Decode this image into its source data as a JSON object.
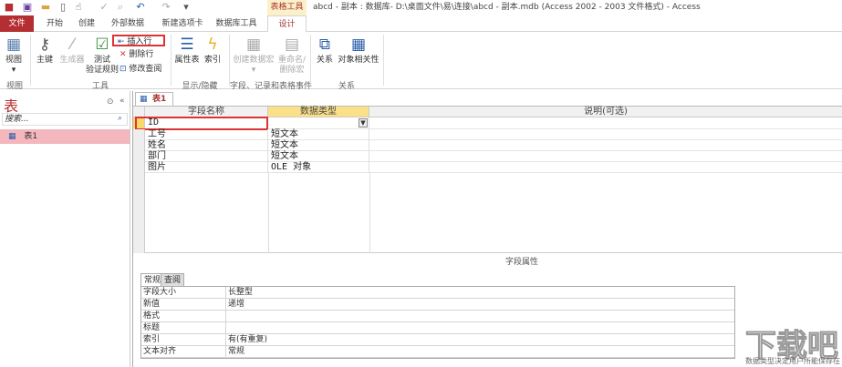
{
  "titlebar": {
    "context_group": "表格工具",
    "title": "abcd - 副本 : 数据库- D:\\桌面文件\\易\\连接\\abcd - 副本.mdb (Access 2002 - 2003 文件格式) - Access"
  },
  "tabs": [
    "文件",
    "开始",
    "创建",
    "外部数据",
    "新建选项卡",
    "数据库工具",
    "设计"
  ],
  "ribbon": {
    "view": "视图",
    "view_group": "视图",
    "primary_key": "主键",
    "builder": "生成器",
    "test_rules_1": "测试",
    "test_rules_2": "验证规则",
    "insert_row": "插入行",
    "delete_row": "删除行",
    "modify_lookup": "修改查阅",
    "tools_group": "工具",
    "property_sheet": "属性表",
    "indexes": "索引",
    "show_hide_group": "显示/隐藏",
    "create_macro": "创建数据宏",
    "rename_macro_1": "重命名/",
    "rename_macro_2": "删除宏",
    "events_group": "字段、记录和表格事件",
    "relationships": "关系",
    "object_dependencies": "对象相关性",
    "relationships_group": "关系"
  },
  "nav": {
    "title": "表",
    "search_placeholder": "搜索...",
    "items": [
      "表1"
    ]
  },
  "document": {
    "tab": "表1",
    "headers": [
      "字段名称",
      "数据类型",
      "说明(可选)"
    ],
    "rows": [
      {
        "name": "ID",
        "type": ""
      },
      {
        "name": "工号",
        "type": "短文本"
      },
      {
        "name": "姓名",
        "type": "短文本"
      },
      {
        "name": "部门",
        "type": "短文本"
      },
      {
        "name": "图片",
        "type": "OLE 对象"
      }
    ]
  },
  "field_properties": {
    "title": "字段属性",
    "tabs": [
      "常规",
      "查阅"
    ],
    "rows": [
      {
        "label": "字段大小",
        "value": "长整型"
      },
      {
        "label": "新值",
        "value": "递增"
      },
      {
        "label": "格式",
        "value": ""
      },
      {
        "label": "标题",
        "value": ""
      },
      {
        "label": "索引",
        "value": "有(有重复)"
      },
      {
        "label": "文本对齐",
        "value": "常规"
      }
    ],
    "hint": "数据类型决定用户所能保存在"
  },
  "watermark": "下载吧"
}
